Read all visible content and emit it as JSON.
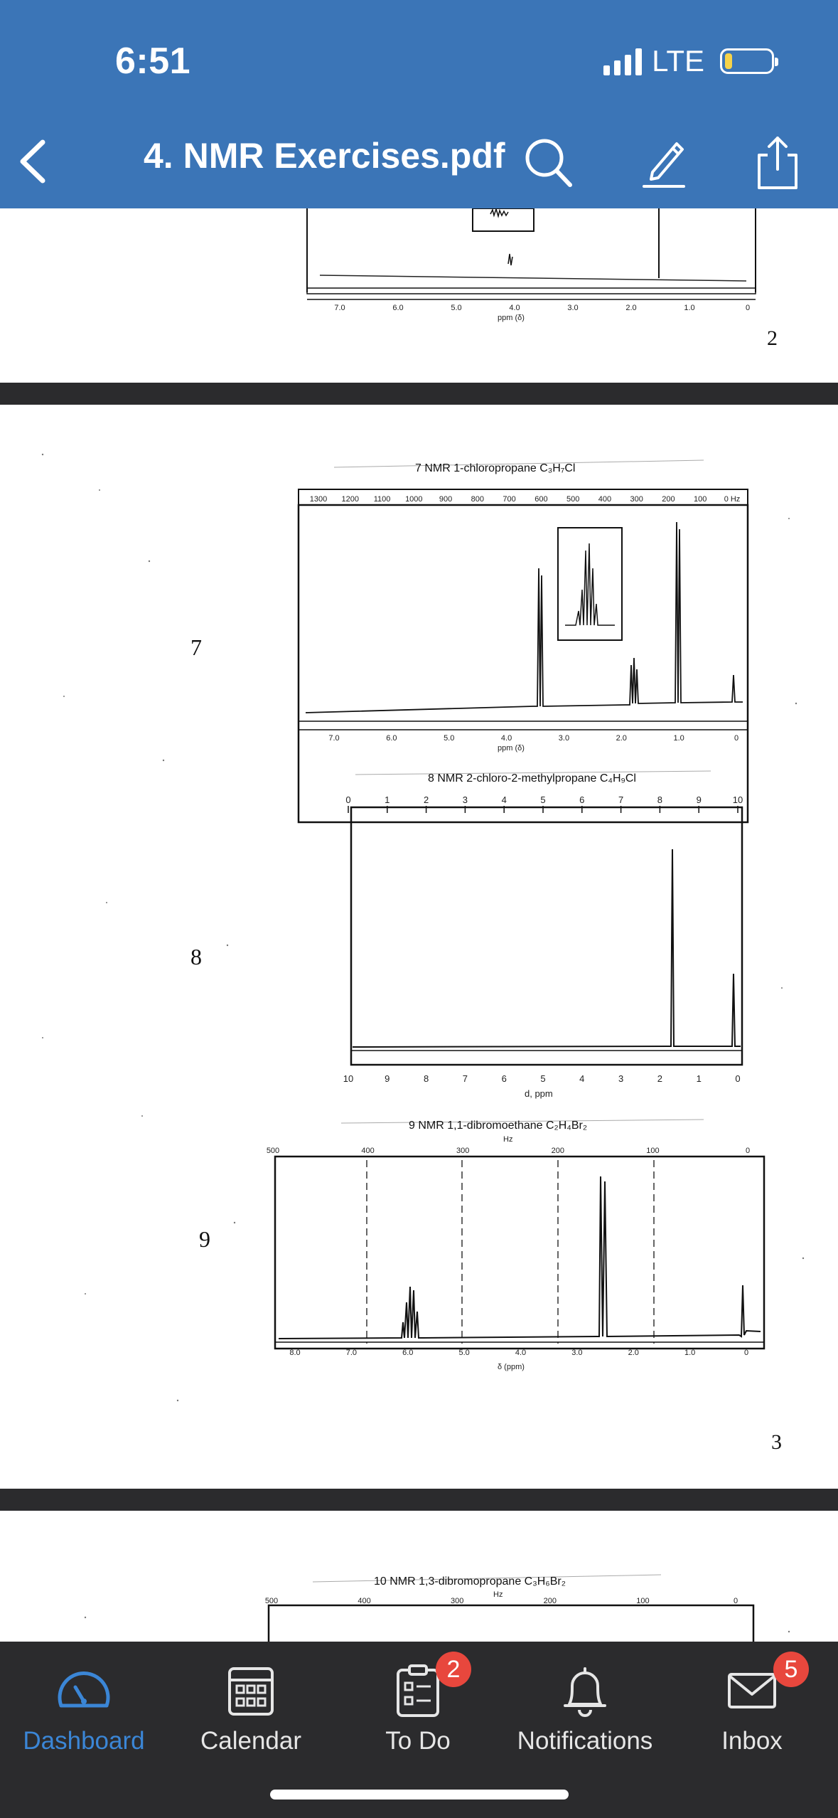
{
  "status_bar": {
    "time": "6:51",
    "network": "LTE"
  },
  "header": {
    "title": "4. NMR Exercises.pdf"
  },
  "document": {
    "page1": {
      "axis_ticks": [
        "7.0",
        "6.0",
        "5.0",
        "4.0",
        "3.0",
        "2.0",
        "1.0",
        "0"
      ],
      "axis_unit": "ppm (δ)",
      "page_number": "2"
    },
    "page2": {
      "spectrum7": {
        "label": "7",
        "caption": "7 NMR 1-chloropropane C₃H₇Cl",
        "hz_ticks": [
          "1300",
          "1200",
          "1100",
          "1000",
          "900",
          "800",
          "700",
          "600",
          "500",
          "400",
          "300",
          "200",
          "100",
          "0 Hz"
        ],
        "ppm_ticks": [
          "7.0",
          "6.0",
          "5.0",
          "4.0",
          "3.0",
          "2.0",
          "1.0",
          "0"
        ],
        "axis_unit": "ppm (δ)"
      },
      "spectrum8": {
        "label": "8",
        "caption": "8 NMR 2-chloro-2-methylpropane C₄H₉Cl",
        "top_ticks": [
          "0",
          "1",
          "2",
          "3",
          "4",
          "5",
          "6",
          "7",
          "8",
          "9",
          "10"
        ],
        "bottom_ticks": [
          "10",
          "9",
          "8",
          "7",
          "6",
          "5",
          "4",
          "3",
          "2",
          "1",
          "0"
        ],
        "axis_unit": "d, ppm"
      },
      "spectrum9": {
        "label": "9",
        "caption": "9 NMR 1,1-dibromoethane C₂H₄Br₂",
        "hz_label": "Hz",
        "hz_ticks": [
          "500",
          "400",
          "300",
          "200",
          "100",
          "0"
        ],
        "ppm_ticks": [
          "8.0",
          "7.0",
          "6.0",
          "5.0",
          "4.0",
          "3.0",
          "2.0",
          "1.0",
          "0"
        ],
        "axis_unit": "δ (ppm)"
      },
      "page_number": "3"
    },
    "page3": {
      "caption": "10 NMR 1,3-dibromopropane C₃H₆Br₂",
      "hz_label": "Hz",
      "hz_ticks": [
        "500",
        "400",
        "300",
        "200",
        "100",
        "0"
      ]
    }
  },
  "tabbar": {
    "tabs": [
      {
        "label": "Dashboard",
        "icon": "dashboard-icon",
        "active": true
      },
      {
        "label": "Calendar",
        "icon": "calendar-icon"
      },
      {
        "label": "To Do",
        "icon": "todo-icon",
        "badge": "2"
      },
      {
        "label": "Notifications",
        "icon": "bell-icon"
      },
      {
        "label": "Inbox",
        "icon": "inbox-icon",
        "badge": "5"
      }
    ]
  },
  "colors": {
    "header": "#3b75b7",
    "tabbar": "#2b2b2d",
    "active": "#3b86d6",
    "badge": "#e8473d"
  }
}
